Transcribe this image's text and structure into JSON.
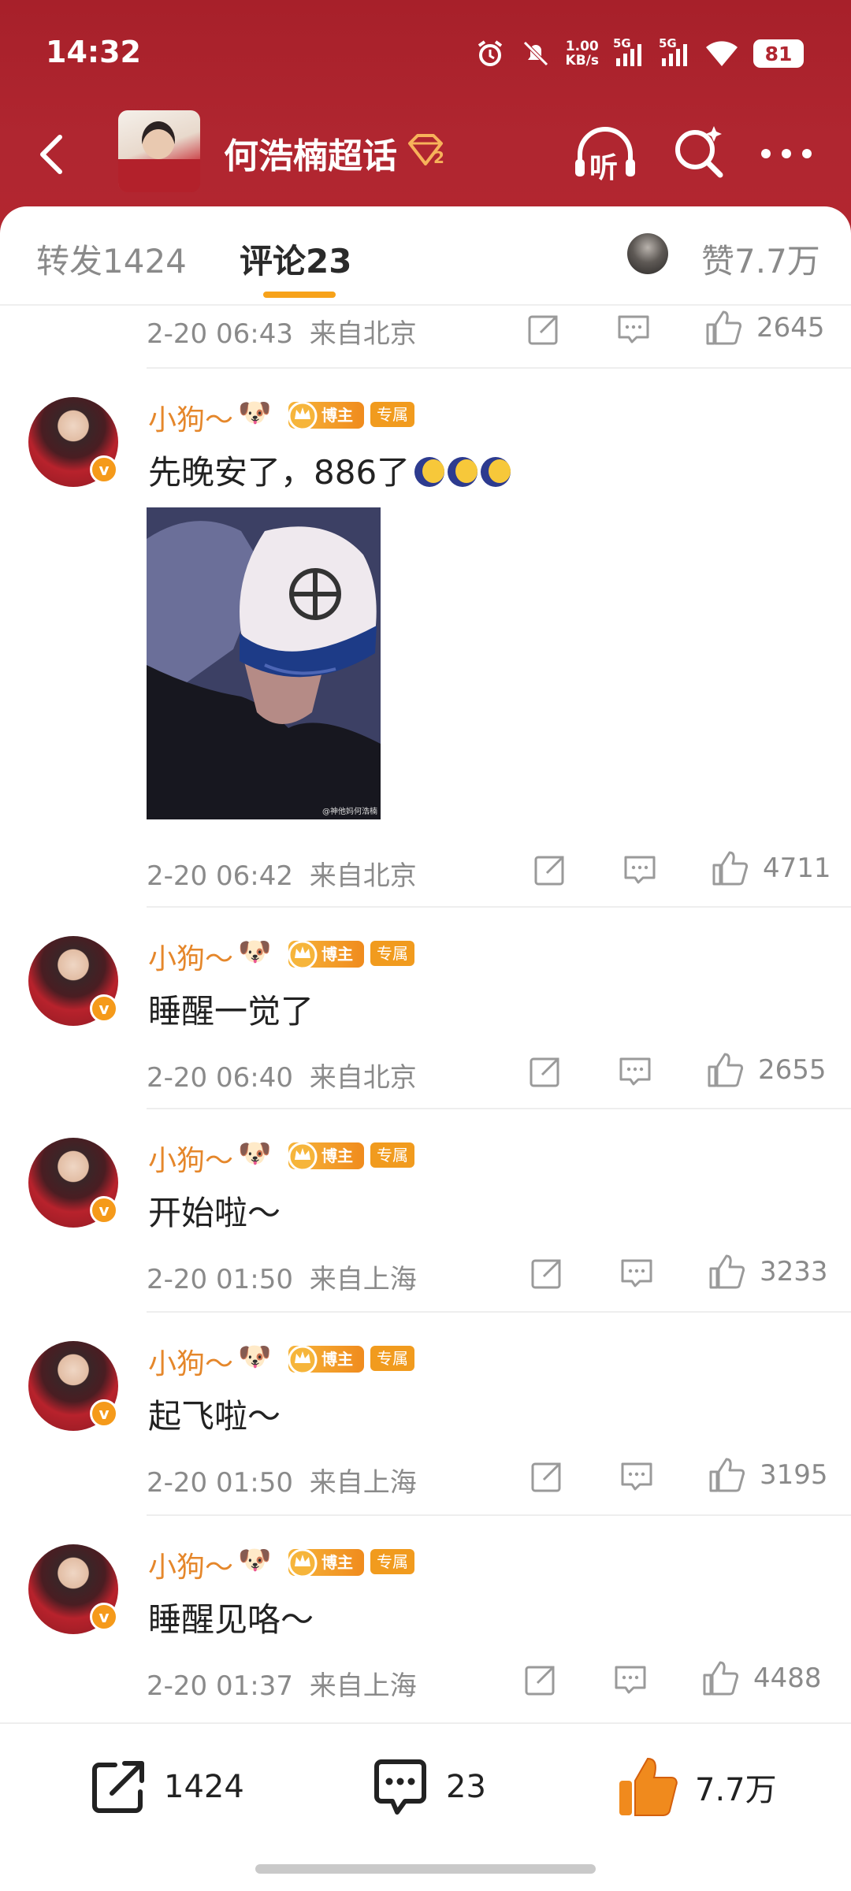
{
  "status_bar": {
    "time": "14:32",
    "net_speed_value": "1.00",
    "net_speed_unit": "KB/s",
    "sim1": "5G",
    "sim2": "5G",
    "battery": "81"
  },
  "header": {
    "topic_title": "何浩楠超话",
    "topic_level_badge": "2",
    "listen_label": "听",
    "icons": [
      "back-arrow-icon",
      "listen-icon",
      "search-icon",
      "more-icon"
    ]
  },
  "tabs": {
    "repost": "转发1424",
    "comments": "评论23",
    "likes": "赞7.7万",
    "accent_color": "#f7a21a"
  },
  "prev_comment": {
    "time": "2-20 06:43",
    "location": "来自北京",
    "likes": "2645"
  },
  "comments": [
    {
      "name": "小狗～",
      "dog_emoji": "🐶",
      "boz_badge": "博主",
      "exclusive_badge": "专属",
      "text": "先晚安了，886了",
      "time": "2-20 06:42",
      "location": "来自北京",
      "likes": "4711"
    },
    {
      "name": "小狗～",
      "dog_emoji": "🐶",
      "boz_badge": "博主",
      "exclusive_badge": "专属",
      "text": "睡醒一觉了",
      "time": "2-20 06:40",
      "location": "来自北京",
      "likes": "2655"
    },
    {
      "name": "小狗～",
      "dog_emoji": "🐶",
      "boz_badge": "博主",
      "exclusive_badge": "专属",
      "text": "开始啦～",
      "time": "2-20 01:50",
      "location": "来自上海",
      "likes": "3233"
    },
    {
      "name": "小狗～",
      "dog_emoji": "🐶",
      "boz_badge": "博主",
      "exclusive_badge": "专属",
      "text": "起飞啦～",
      "time": "2-20 01:50",
      "location": "来自上海",
      "likes": "3195"
    },
    {
      "name": "小狗～",
      "dog_emoji": "🐶",
      "boz_badge": "博主",
      "exclusive_badge": "专属",
      "text": "睡醒见咯～",
      "time": "2-20 01:37",
      "location": "来自上海",
      "likes": "4488"
    }
  ],
  "photo_watermark": "@神他妈何浩楠",
  "verified_mark": "v",
  "bottom_bar": {
    "repost_count": "1424",
    "comment_count": "23",
    "like_count": "7.7万",
    "like_color": "#f08a1d"
  }
}
